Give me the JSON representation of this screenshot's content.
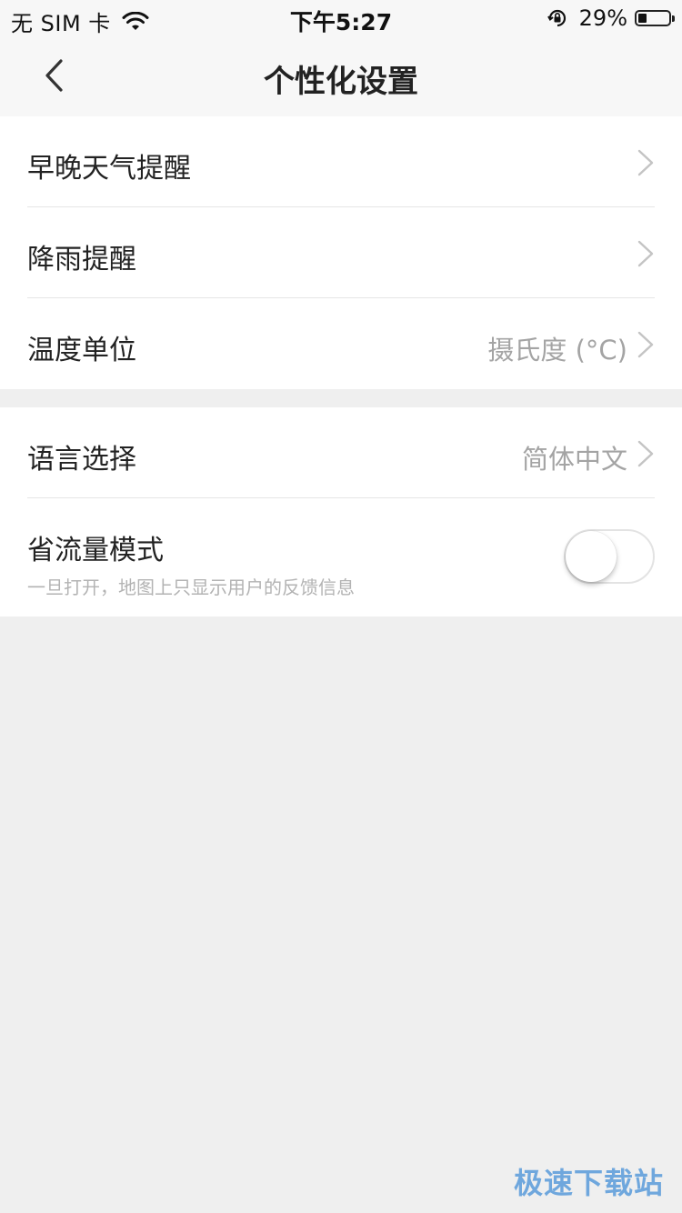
{
  "status_bar": {
    "carrier": "无 SIM 卡",
    "time": "下午5:27",
    "battery_percent": "29%",
    "battery_level": 0.29,
    "icons": [
      "wifi-icon",
      "rotation-lock-icon",
      "battery-icon"
    ]
  },
  "nav": {
    "title": "个性化设置",
    "back_icon": "chevron-left-icon"
  },
  "settings": {
    "group1": [
      {
        "label": "早晚天气提醒",
        "value": ""
      },
      {
        "label": "降雨提醒",
        "value": ""
      },
      {
        "label": "温度单位",
        "value": "摄氏度 (°C)"
      }
    ],
    "group2": {
      "language": {
        "label": "语言选择",
        "value": "简体中文"
      },
      "data_saver": {
        "label": "省流量模式",
        "subtitle": "一旦打开，地图上只显示用户的反馈信息",
        "enabled": false
      }
    }
  },
  "watermark": "极速下载站",
  "colors": {
    "background": "#efefef",
    "card": "#ffffff",
    "secondary_text": "#a4a4a4",
    "watermark": "#6fa7dd"
  }
}
